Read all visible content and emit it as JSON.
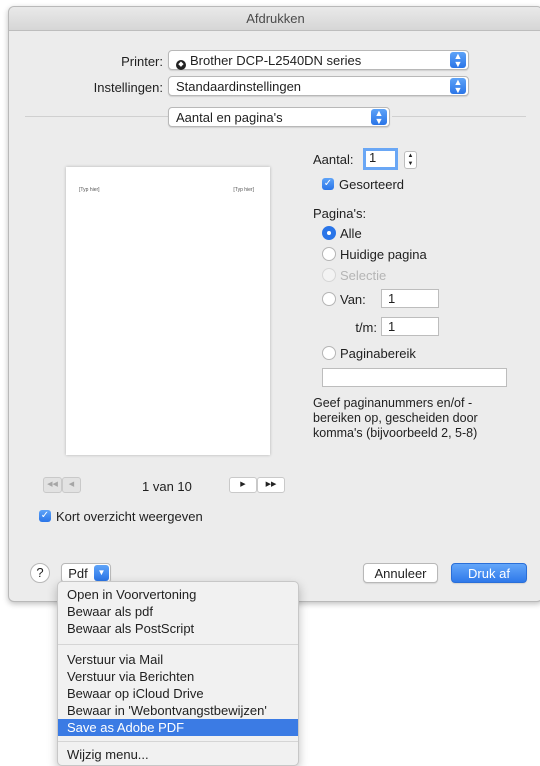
{
  "window": {
    "title": "Afdrukken"
  },
  "printer": {
    "label": "Printer:",
    "value": "Brother DCP-L2540DN series"
  },
  "settings": {
    "label": "Instellingen:",
    "value": "Standaardinstellingen"
  },
  "section": {
    "value": "Aantal en pagina's"
  },
  "preview": {
    "header_left": "[Typ hier]",
    "header_right": "[Typ hier]",
    "page_info": "1 van 10",
    "nav_first": "◀◀",
    "nav_prev": "◀",
    "nav_next": "▶",
    "nav_last": "▶▶"
  },
  "show_details": {
    "label": "Kort overzicht weergeven",
    "checked": true
  },
  "copies": {
    "label": "Aantal:",
    "value": "1",
    "collated_label": "Gesorteerd"
  },
  "pages": {
    "label": "Pagina's:",
    "all": "Alle",
    "current": "Huidige pagina",
    "selection": "Selectie",
    "from_label": "Van:",
    "from_value": "1",
    "to_label": "t/m:",
    "to_value": "1",
    "range_label": "Paginabereik",
    "range_value": "",
    "help": "Geef paginanummers en/of -bereiken op, gescheiden door komma's (bijvoorbeeld 2, 5-8)"
  },
  "footer": {
    "help": "?",
    "pdf": "Pdf",
    "cancel": "Annuleer",
    "print": "Druk af"
  },
  "pdf_menu": {
    "group1": [
      "Open in Voorvertoning",
      "Bewaar als pdf",
      "Bewaar als PostScript"
    ],
    "group2": [
      "Verstuur via Mail",
      "Verstuur via Berichten",
      "Bewaar op iCloud Drive",
      "Bewaar in 'Webontvangstbewijzen'",
      "Save as Adobe PDF"
    ],
    "group3": [
      "Wijzig menu..."
    ],
    "selected": "Save as Adobe PDF"
  },
  "colors": {
    "accent": "#2a75e8",
    "menu_highlight": "#3b7be4"
  }
}
